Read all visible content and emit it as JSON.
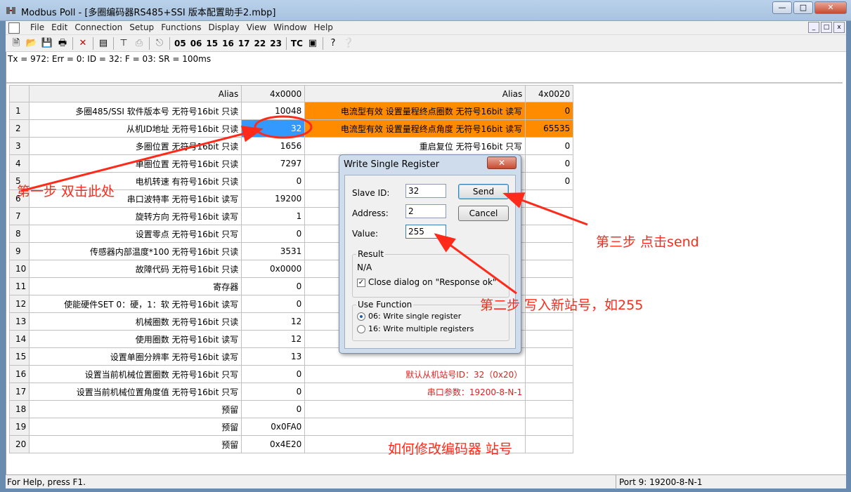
{
  "window": {
    "title": "Modbus Poll - [多圈编码器RS485+SSI 版本配置助手2.mbp]",
    "min": "0",
    "max": "1",
    "close": "r"
  },
  "menu": [
    "File",
    "Edit",
    "Connection",
    "Setup",
    "Functions",
    "Display",
    "View",
    "Window",
    "Help"
  ],
  "toolbar": {
    "fc_codes": [
      "05",
      "06",
      "15",
      "16",
      "17",
      "22",
      "23"
    ],
    "tc": "TC"
  },
  "status_line": "Tx = 972: Err = 0: ID = 32: F = 03: SR = 100ms",
  "grid": {
    "headers": {
      "alias1": "Alias",
      "col1": "4x0000",
      "alias2": "Alias",
      "col2": "4x0020"
    },
    "rows": [
      {
        "n": "1",
        "a1": "多圈485/SSI  软件版本号 无符号16bit 只读",
        "v1": "10048",
        "a2": "电流型有效 设置量程终点圈数 无符号16bit 读写",
        "v2": "0"
      },
      {
        "n": "2",
        "a1": "从机ID地址 无符号16bit 只读",
        "v1": "32",
        "a2": "电流型有效 设置量程终点角度 无符号16bit 读写",
        "v2": "65535"
      },
      {
        "n": "3",
        "a1": "多圈位置 无符号16bit 只读",
        "v1": "1656",
        "a2": "重启复位 无符号16bit 只写",
        "v2": "0"
      },
      {
        "n": "4",
        "a1": "单圈位置 无符号16bit 只读",
        "v1": "7297",
        "a2": "",
        "v2": "0"
      },
      {
        "n": "5",
        "a1": "电机转速 有符号16bit 只读",
        "v1": "0",
        "a2": "",
        "v2": "0"
      },
      {
        "n": "6",
        "a1": "串口波特率 无符号16bit 读写",
        "v1": "19200",
        "a2": "",
        "v2": ""
      },
      {
        "n": "7",
        "a1": "旋转方向 无符号16bit 读写",
        "v1": "1",
        "a2": "",
        "v2": ""
      },
      {
        "n": "8",
        "a1": "设置零点 无符号16bit 只写",
        "v1": "0",
        "a2": "",
        "v2": ""
      },
      {
        "n": "9",
        "a1": "传感器内部温度*100 无符号16bit 只读",
        "v1": "3531",
        "a2": "",
        "v2": ""
      },
      {
        "n": "10",
        "a1": "故障代码 无符号16bit 只读",
        "v1": "0x0000",
        "a2": "",
        "v2": ""
      },
      {
        "n": "11",
        "a1": "寄存器",
        "v1": "0",
        "a2": "",
        "v2": ""
      },
      {
        "n": "12",
        "a1": "使能硬件SET 0：硬，1：软 无符号16bit 读写",
        "v1": "0",
        "a2": "",
        "v2": ""
      },
      {
        "n": "13",
        "a1": "机械圈数 无符号16bit 只读",
        "v1": "12",
        "a2": "",
        "v2": ""
      },
      {
        "n": "14",
        "a1": "使用圈数 无符号16bit 读写",
        "v1": "12",
        "a2": "",
        "v2": ""
      },
      {
        "n": "15",
        "a1": "设置单圈分辨率 无符号16bit 读写",
        "v1": "13",
        "a2": "",
        "v2": ""
      },
      {
        "n": "16",
        "a1": "设置当前机械位置圈数 无符号16bit 只写",
        "v1": "0",
        "a2": "默认从机站号ID：32（0x20）",
        "v2": ""
      },
      {
        "n": "17",
        "a1": "设置当前机械位置角度值 无符号16bit 只写",
        "v1": "0",
        "a2": "串口参数：19200-8-N-1",
        "v2": ""
      },
      {
        "n": "18",
        "a1": "预留",
        "v1": "0",
        "a2": "",
        "v2": ""
      },
      {
        "n": "19",
        "a1": "预留",
        "v1": "0x0FA0",
        "a2": "",
        "v2": ""
      },
      {
        "n": "20",
        "a1": "预留",
        "v1": "0x4E20",
        "a2": "",
        "v2": ""
      }
    ]
  },
  "dialog": {
    "title": "Write Single Register",
    "slave_id_label": "Slave ID:",
    "slave_id_value": "32",
    "address_label": "Address:",
    "address_value": "2",
    "value_label": "Value:",
    "value_value": "255",
    "send": "Send",
    "cancel": "Cancel",
    "result_title": "Result",
    "result_value": "N/A",
    "close_on_ok": "Close dialog on \"Response ok\"",
    "use_function_title": "Use Function",
    "fn06": "06: Write single register",
    "fn16": "16: Write multiple registers"
  },
  "annotations": {
    "step1": "第一步 双击此处",
    "step2": "第二步 写入新站号，如255",
    "step3": "第三步 点击send",
    "title": "如何修改编码器 站号"
  },
  "statusbar": {
    "help": "For Help, press F1.",
    "port": "Port 9: 19200-8-N-1"
  },
  "colors": {
    "highlight": "#ff8c00",
    "selection": "#3399ff",
    "annotation": "#ff2a1a"
  }
}
